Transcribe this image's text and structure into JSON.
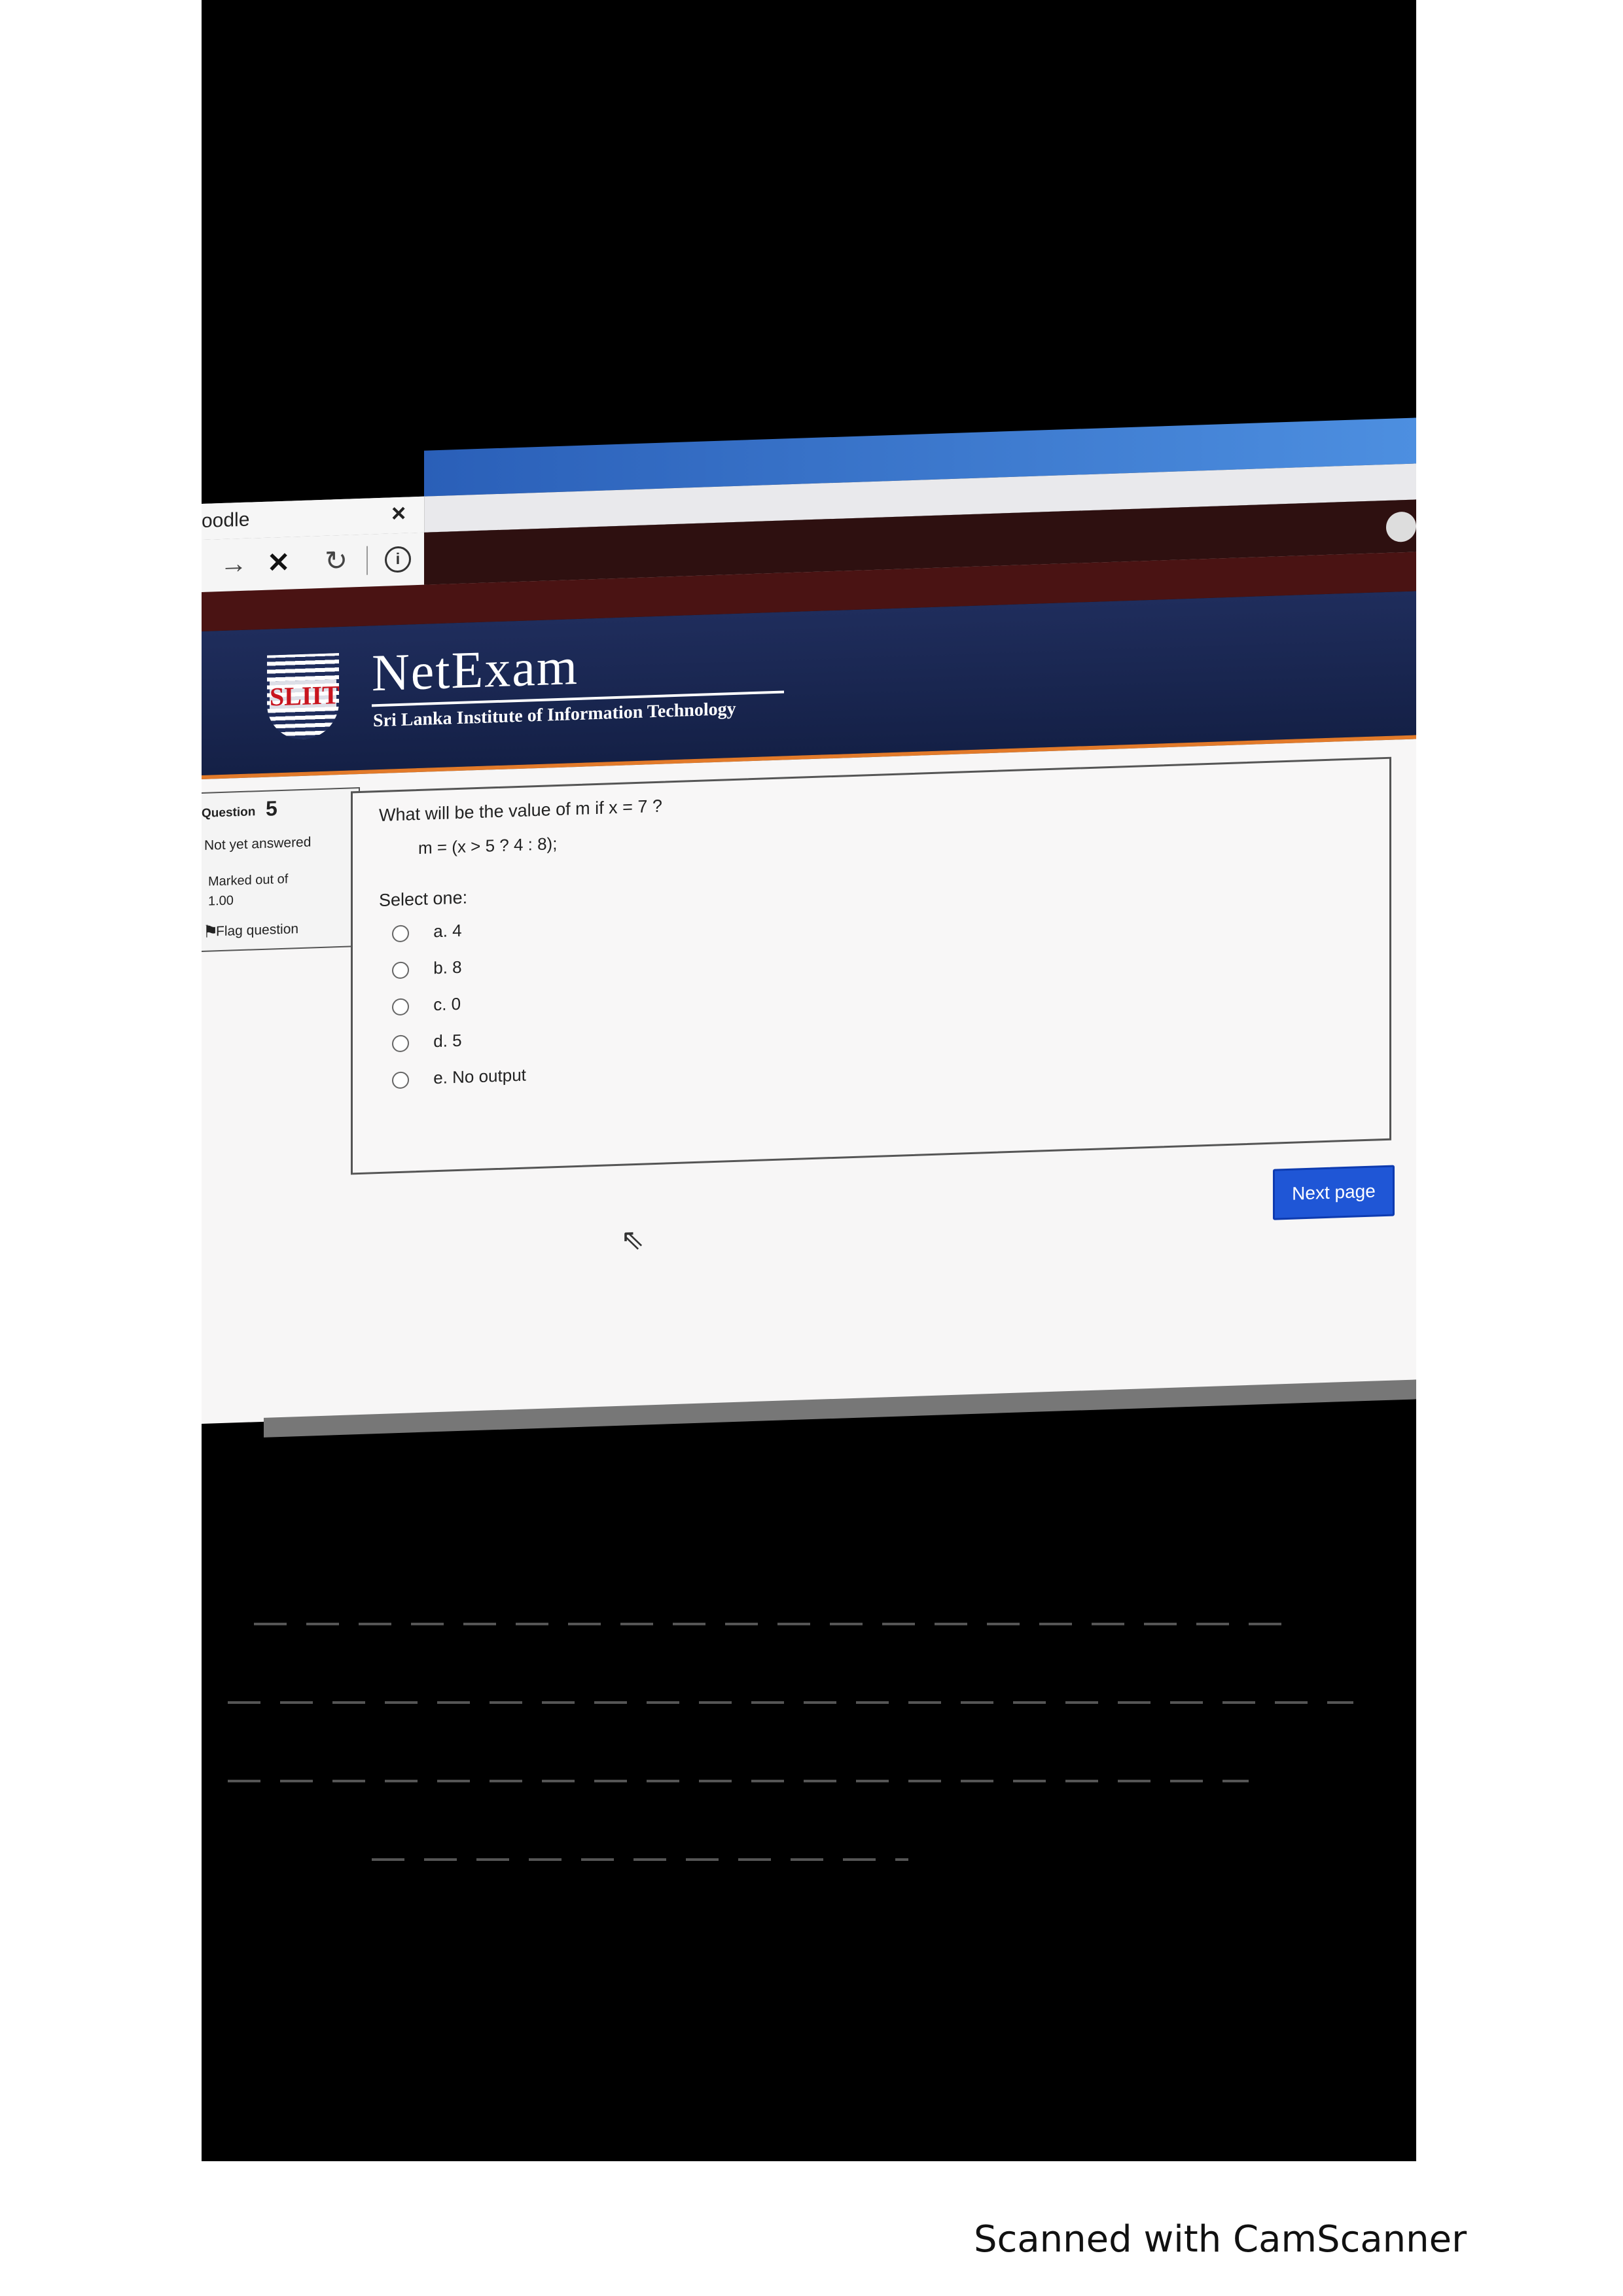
{
  "browser": {
    "tab_title": "oodle",
    "tab_close": "×",
    "back": "→",
    "stop": "✕",
    "reload": "↻",
    "info_icon": "i"
  },
  "header": {
    "brand_name": "NetExam",
    "brand_sub": "Sri Lanka Institute of Information Technology",
    "crest_text": "SLIIT"
  },
  "question_info": {
    "label": "Question",
    "number": "5",
    "state": "Not yet answered",
    "marks_label": "Marked out of",
    "marks_value": "1.00",
    "flag_label": "Flag question"
  },
  "question": {
    "text": "What will be the value of m if x = 7 ?",
    "code": "m = (x  > 5 ? 4 : 8);",
    "select_prompt": "Select one:",
    "options": [
      {
        "label": "a. 4"
      },
      {
        "label": "b. 8"
      },
      {
        "label": "c. 0"
      },
      {
        "label": "d. 5"
      },
      {
        "label": "e. No output"
      }
    ]
  },
  "navigation": {
    "next_label": "Next page"
  },
  "footer": {
    "text": "Scanned with CamScanner"
  }
}
